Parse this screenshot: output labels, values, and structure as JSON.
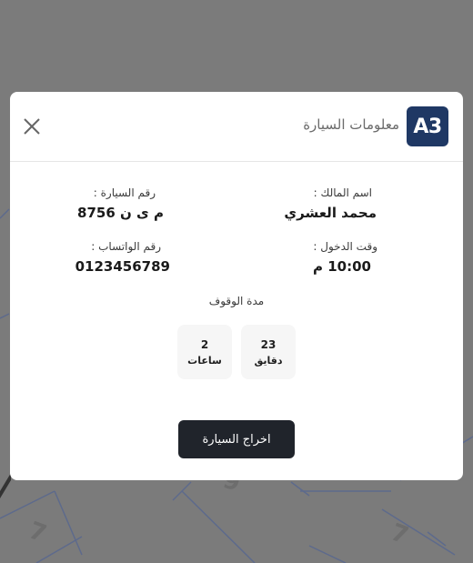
{
  "modal": {
    "badge": "A3",
    "title": "معلومات السيارة",
    "fields": {
      "owner_label": "اسم المالك :",
      "owner_value": "محمد العشري",
      "plate_label": "رقم السيارة :",
      "plate_value": "م ى ن 8756",
      "entry_label": "وقت الدخول :",
      "entry_value": "10:00 م",
      "whatsapp_label": "رقم الواتساب :",
      "whatsapp_value": "0123456789"
    },
    "duration": {
      "label": "مدة الوقوف",
      "minutes": {
        "value": "23",
        "unit": "دقايق"
      },
      "hours": {
        "value": "2",
        "unit": "ساعات"
      }
    },
    "action_button": "اخراج السيارة"
  },
  "background": {
    "parking_numbers": [
      "7",
      "6",
      "7"
    ]
  }
}
